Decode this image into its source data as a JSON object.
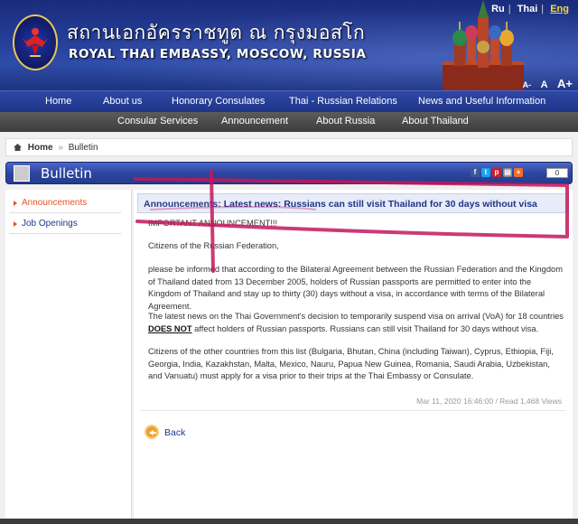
{
  "header": {
    "thai_title": "สถานเอกอัครราชทูต ณ กรุงมอสโก",
    "en_title": "ROYAL THAI EMBASSY, MOSCOW, RUSSIA",
    "languages": [
      "Ru",
      "Thai",
      "Eng"
    ],
    "font_sizes": [
      "A-",
      "A",
      "A+"
    ]
  },
  "nav_primary": [
    "Home",
    "About us",
    "Honorary Consulates",
    "Thai - Russian Relations",
    "News and Useful Information"
  ],
  "nav_secondary": [
    "Consular Services",
    "Announcement",
    "About Russia",
    "About Thailand"
  ],
  "breadcrumb": {
    "home": "Home",
    "current": "Bulletin"
  },
  "section_title": "Bulletin",
  "share_count": "0",
  "sidebar": {
    "items": [
      "Announcements",
      "Job Openings"
    ]
  },
  "article": {
    "category": "Announcements",
    "headline": "Latest news: Russians can still visit Thailand for 30 days without visa",
    "p0": "IMPORTANT ANNOUNCEMENT!!!",
    "p1": "Citizens of the Russian Federation,",
    "p2": "please be informed that according to the Bilateral Agreement between the Russian Federation and the Kingdom of Thailand dated from 13 December 2005, holders of Russian passports are permitted to enter into the Kingdom of Thailand and stay up to thirty (30) days without a visa, in accordance with terms of the Bilateral Agreement.",
    "p3_a": "The latest news on the Thai Government's decision to temporarily suspend visa on arrival (VoA) for 18 countries",
    "p3_bold": "DOES NOT",
    "p3_b": "affect holders of Russian passports. Russians can still visit Thailand for 30 days without visa.",
    "p4": "Citizens of the other countries from this list (Bulgaria, Bhutan, China (including Taiwan), Cyprus, Ethiopia, Fiji, Georgia, India, Kazakhstan, Malta, Mexico, Nauru, Papua New Guinea, Romania, Saudi Arabia, Uzbekistan, and Vanuatu) must apply for a visa prior to their trips at the Thai Embassy or Consulate.",
    "meta": "Mar 11, 2020 16:46:00 / Read 1,468 Views",
    "back_label": "Back"
  },
  "colors": {
    "accent": "#1f3588",
    "annotation": "#c2185b",
    "active": "#e8522a"
  }
}
